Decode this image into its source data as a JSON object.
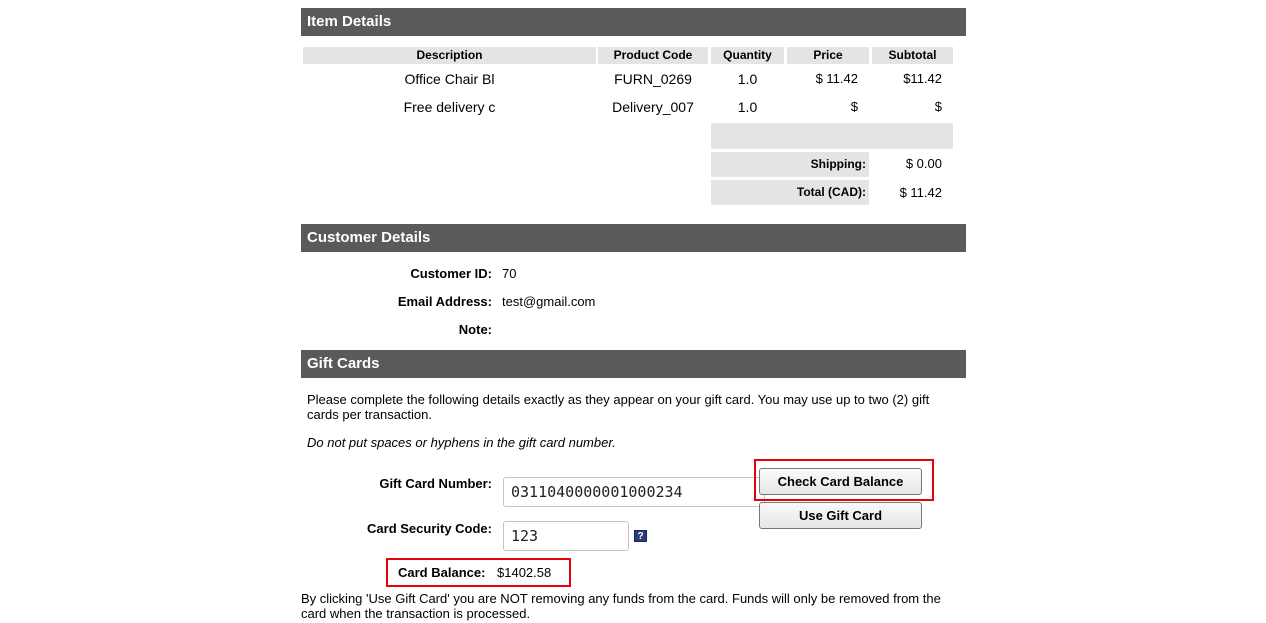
{
  "item_details": {
    "header": "Item Details",
    "columns": [
      "Description",
      "Product Code",
      "Quantity",
      "Price",
      "Subtotal"
    ],
    "rows": [
      {
        "description": "Office Chair Bl",
        "product_code": "FURN_0269",
        "quantity": "1.0",
        "price": "$ 11.42",
        "subtotal": "$11.42"
      },
      {
        "description": "Free delivery c",
        "product_code": "Delivery_007",
        "quantity": "1.0",
        "price": "$",
        "subtotal": "$"
      }
    ],
    "shipping_label": "Shipping:",
    "shipping_value": "$ 0.00",
    "total_label": "Total (CAD):",
    "total_value": "$ 11.42"
  },
  "customer_details": {
    "header": "Customer Details",
    "customer_id_label": "Customer ID:",
    "customer_id": "70",
    "email_label": "Email Address:",
    "email": "test@gmail.com",
    "note_label": "Note:"
  },
  "gift_cards": {
    "header": "Gift Cards",
    "instructions": "Please complete the following details exactly as they appear on your gift card. You may use up to two (2) gift cards per transaction.",
    "no_spaces_note": "Do not put spaces or hyphens in the gift card number.",
    "card_number_label": "Gift Card Number:",
    "card_number_value": "0311040000001000234",
    "security_code_label": "Card Security Code:",
    "security_code_value": "123",
    "help_icon_text": "?",
    "check_balance_button": "Check Card Balance",
    "use_gift_card_button": "Use Gift Card",
    "balance_label": "Card Balance:",
    "balance_value": "$1402.58",
    "disclaimer": "By clicking 'Use Gift Card' you are NOT removing any funds from the card. Funds will only be removed from the card when the transaction is processed."
  },
  "colors": {
    "header_bg": "#5a5a5a",
    "highlight": "#e8000a",
    "table_header_bg": "#e4e4e4"
  }
}
